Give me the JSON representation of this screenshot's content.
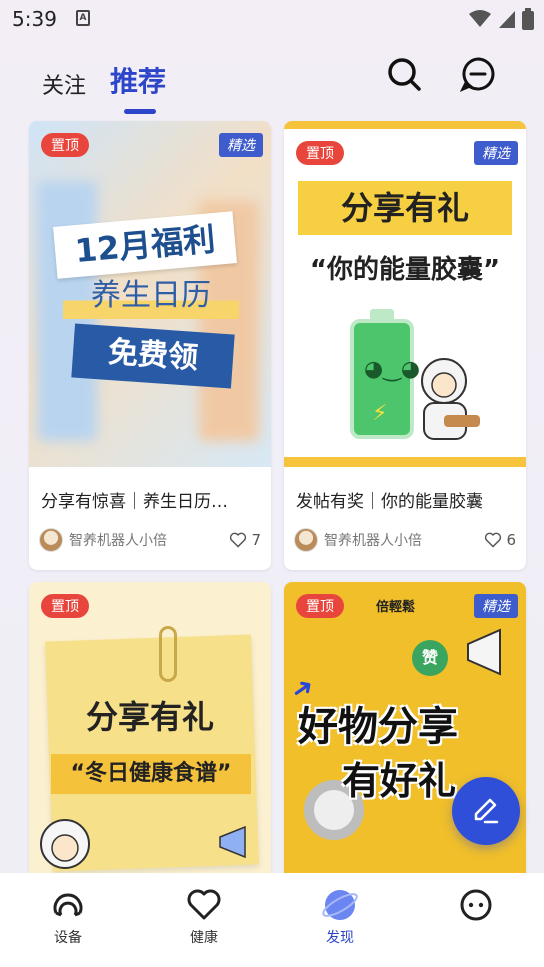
{
  "status_bar": {
    "time": "5:39",
    "notif_letter": "A"
  },
  "top_tabs": [
    {
      "label": "关注",
      "active": false
    },
    {
      "label": "推荐",
      "active": true
    }
  ],
  "feed": [
    {
      "badge_top": "置顶",
      "badge_pick": "精选",
      "image_text": [
        "12月福利",
        "养生日历",
        "免费领"
      ],
      "title": "分享有惊喜｜养生日历…",
      "author": "智养机器人小倍",
      "likes": "7"
    },
    {
      "badge_top": "置顶",
      "badge_pick": "精选",
      "image_text": [
        "分享有礼",
        "“你的能量胶囊”"
      ],
      "title": "发帖有奖｜你的能量胶囊",
      "author": "智养机器人小倍",
      "likes": "6"
    },
    {
      "badge_top": "置顶",
      "image_text": [
        "分享有礼",
        "“冬日健康食谱”"
      ]
    },
    {
      "badge_top": "置顶",
      "badge_pick": "精选",
      "image_text": [
        "倍輕鬆",
        "赞",
        "好物分享",
        "有好礼"
      ]
    }
  ],
  "bottom_nav": [
    {
      "label": "设备",
      "icon": "device-icon",
      "active": false
    },
    {
      "label": "健康",
      "icon": "heart-icon",
      "active": false
    },
    {
      "label": "发现",
      "icon": "discover-icon",
      "active": true
    },
    {
      "label": "",
      "icon": "profile-icon",
      "active": false
    }
  ],
  "colors": {
    "accent": "#2d46c9",
    "badge_red": "#e8453c",
    "badge_blue": "#3f5ccc"
  }
}
